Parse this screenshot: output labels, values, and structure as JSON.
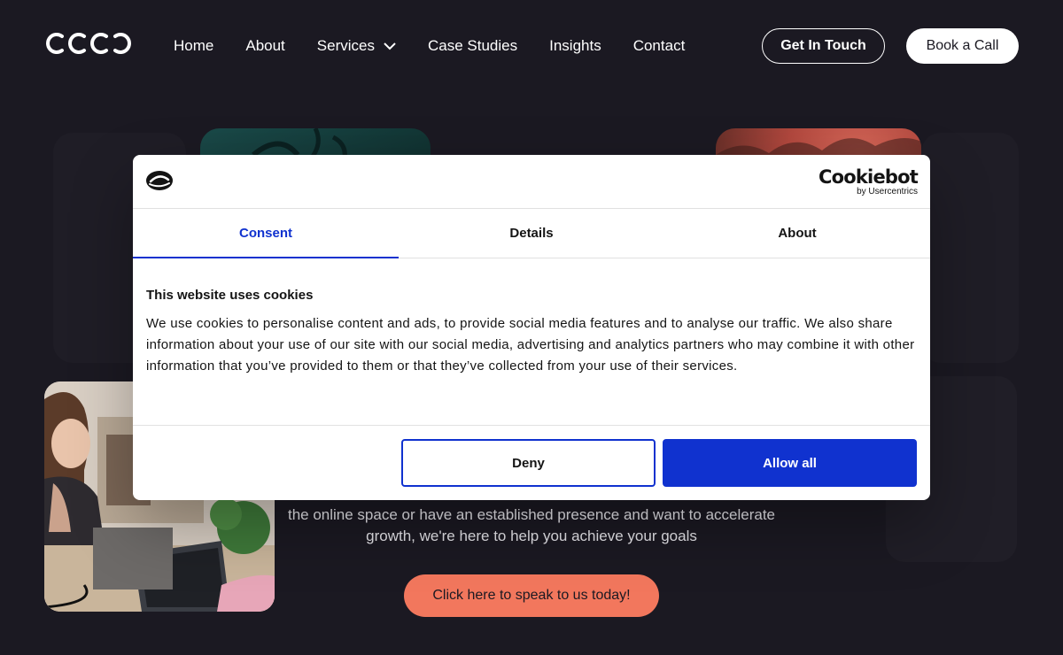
{
  "header": {
    "logo_alt": "coco",
    "nav": [
      {
        "label": "Home"
      },
      {
        "label": "About"
      },
      {
        "label": "Services"
      },
      {
        "label": "Case Studies"
      },
      {
        "label": "Insights"
      },
      {
        "label": "Contact"
      }
    ],
    "get_in_touch_label": "Get In Touch",
    "book_call_label": "Book a Call"
  },
  "hero": {
    "line1": "the online space or have an established presence and want to accelerate",
    "line2": "growth, we're here to help you achieve your goals",
    "cta_label": "Click here to speak to us today!"
  },
  "cookie_modal": {
    "brand_name": "Cookiebot",
    "brand_by": "by Usercentrics",
    "tabs": [
      {
        "label": "Consent",
        "active": true
      },
      {
        "label": "Details",
        "active": false
      },
      {
        "label": "About",
        "active": false
      }
    ],
    "title": "This website uses cookies",
    "body": "We use cookies to personalise content and ads, to provide social media features and to analyse our traffic. We also share information about your use of our site with our social media, advertising and analytics partners who may combine it with other information that you’ve provided to them or that they’ve collected from your use of their services.",
    "deny_label": "Deny",
    "allow_label": "Allow all"
  },
  "colors": {
    "page_bg": "#1b1922",
    "accent_blue": "#1032cf",
    "cta_coral": "#f2775d"
  },
  "icons": {
    "services_dropdown": "chevron-down-icon",
    "cookiebot_badge": "cookie-badge-icon"
  }
}
